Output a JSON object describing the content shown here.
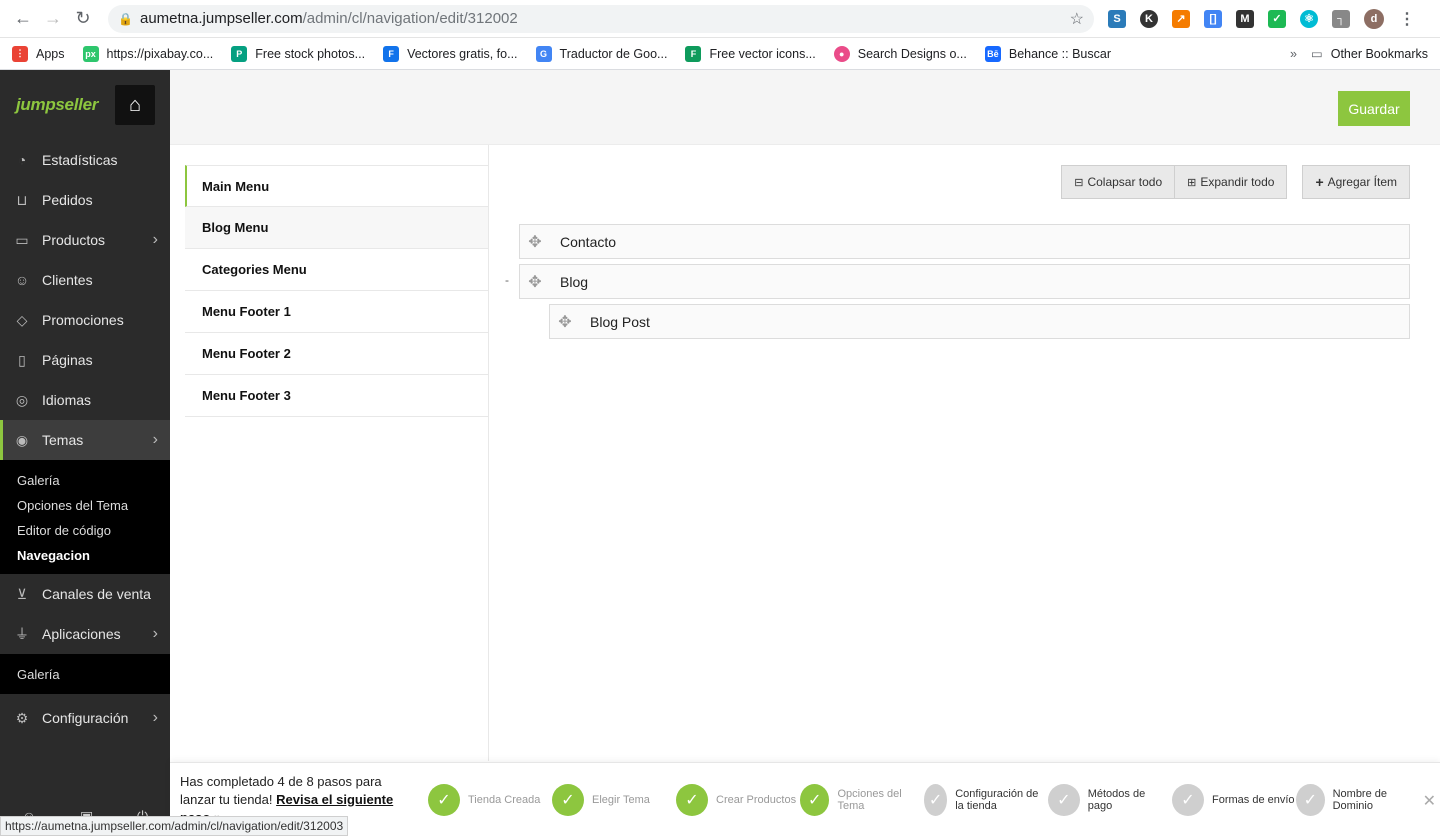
{
  "browser": {
    "url_host": "aumetna.jumpseller.com",
    "url_path": "/admin/cl/navigation/edit/312002",
    "bookmarks": [
      {
        "label": "Apps",
        "color": "#ea4335",
        "icon": "apps-grid-icon"
      },
      {
        "label": "https://pixabay.co...",
        "color": "#2ec66d",
        "icon": "pixabay-icon"
      },
      {
        "label": "Free stock photos...",
        "color": "#05a081",
        "icon": "pexels-icon"
      },
      {
        "label": "Vectores gratis, fo...",
        "color": "#1273eb",
        "icon": "freepik-icon"
      },
      {
        "label": "Traductor de Goo...",
        "color": "#4285f4",
        "icon": "google-translate-icon"
      },
      {
        "label": "Free vector icons...",
        "color": "#0e9b5c",
        "icon": "flaticon-icon"
      },
      {
        "label": "Search Designs o...",
        "color": "#ea4c89",
        "icon": "dribbble-icon"
      },
      {
        "label": "Behance :: Buscar",
        "color": "#1769ff",
        "icon": "behance-icon"
      }
    ],
    "other_bookmarks": "Other Bookmarks",
    "status_url": "https://aumetna.jumpseller.com/admin/cl/navigation/edit/312003"
  },
  "sidebar": {
    "logo": "jumpseller",
    "items": [
      {
        "label": "Estadísticas",
        "icon": "gauge-icon"
      },
      {
        "label": "Pedidos",
        "icon": "basket-icon"
      },
      {
        "label": "Productos",
        "icon": "box-icon"
      },
      {
        "label": "Clientes",
        "icon": "users-icon"
      },
      {
        "label": "Promociones",
        "icon": "tags-icon"
      },
      {
        "label": "Páginas",
        "icon": "page-icon"
      },
      {
        "label": "Idiomas",
        "icon": "globe-icon"
      },
      {
        "label": "Temas",
        "icon": "eye-icon"
      }
    ],
    "temas_sub": [
      "Galería",
      "Opciones del Tema",
      "Editor de código",
      "Navegacion"
    ],
    "canales": "Canales de venta",
    "aplicaciones": "Aplicaciones",
    "aplicaciones_sub": "Galería",
    "configuracion": "Configuración"
  },
  "header": {
    "save_label": "Guardar"
  },
  "menus": [
    "Main Menu",
    "Blog Menu",
    "Categories Menu",
    "Menu Footer 1",
    "Menu Footer 2",
    "Menu Footer 3"
  ],
  "toolbar": {
    "collapse": "Colapsar todo",
    "expand": "Expandir todo",
    "add": "Agregar Ítem"
  },
  "tree": {
    "item1": "Contacto",
    "item2": "Blog",
    "item2_child": "Blog Post",
    "collapse_mark": "-"
  },
  "onboarding": {
    "text": "Has completado 4 de 8 pasos para lanzar tu tienda!",
    "link": "Revisa el siguiente paso »",
    "steps": [
      {
        "label": "Tienda Creada",
        "done": true
      },
      {
        "label": "Elegir Tema",
        "done": true
      },
      {
        "label": "Crear Productos",
        "done": true
      },
      {
        "label": "Opciones del Tema",
        "done": true
      },
      {
        "label": "Configuración de la tienda",
        "done": false
      },
      {
        "label": "Métodos de pago",
        "done": false
      },
      {
        "label": "Formas de envío",
        "done": false
      },
      {
        "label": "Nombre de Dominio",
        "done": false
      }
    ]
  }
}
